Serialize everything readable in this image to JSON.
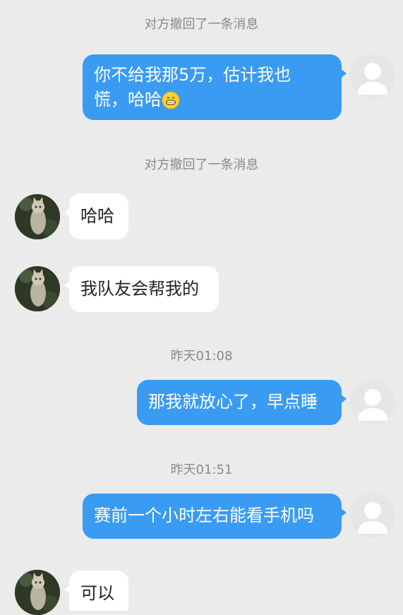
{
  "chat": {
    "system_top": "对方撤回了一条消息",
    "msg1": {
      "line1": "你不给我那5万，估计我也",
      "line2": "慌，哈哈",
      "emoji": "grinning-face-icon"
    },
    "system_mid": "对方撤回了一条消息",
    "msg2": "哈哈",
    "msg3": "我队友会帮我的",
    "time1": "昨天01:08",
    "msg4": "那我就放心了，早点睡",
    "time2": "昨天01:51",
    "msg5": "赛前一个小时左右能看手机吗",
    "msg6": "可以"
  },
  "colors": {
    "background": "#ebebeb",
    "outgoing_bubble": "#3a9bf3",
    "incoming_bubble": "#ffffff",
    "system_text": "#8a8a8a"
  }
}
